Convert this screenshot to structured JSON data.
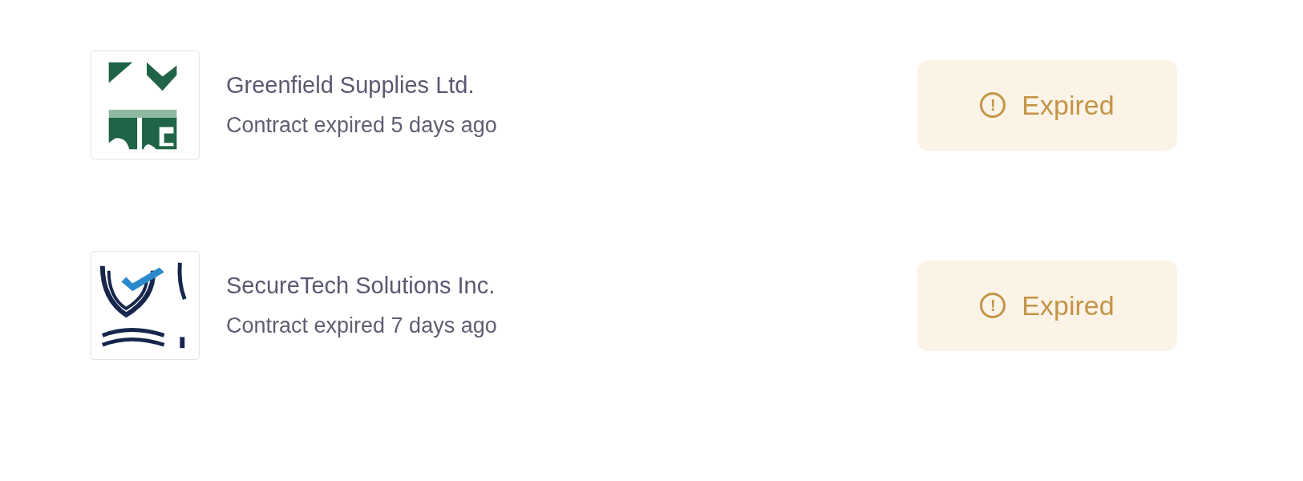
{
  "contracts": [
    {
      "name": "Greenfield Supplies Ltd.",
      "subtitle": "Contract expired 5 days ago",
      "status": {
        "kind": "expired",
        "label": "Expired",
        "icon": "!"
      }
    },
    {
      "name": "SecureTech Solutions Inc.",
      "subtitle": "Contract expired 7 days ago",
      "status": {
        "kind": "expired",
        "label": "Expired",
        "icon": "!"
      }
    }
  ]
}
